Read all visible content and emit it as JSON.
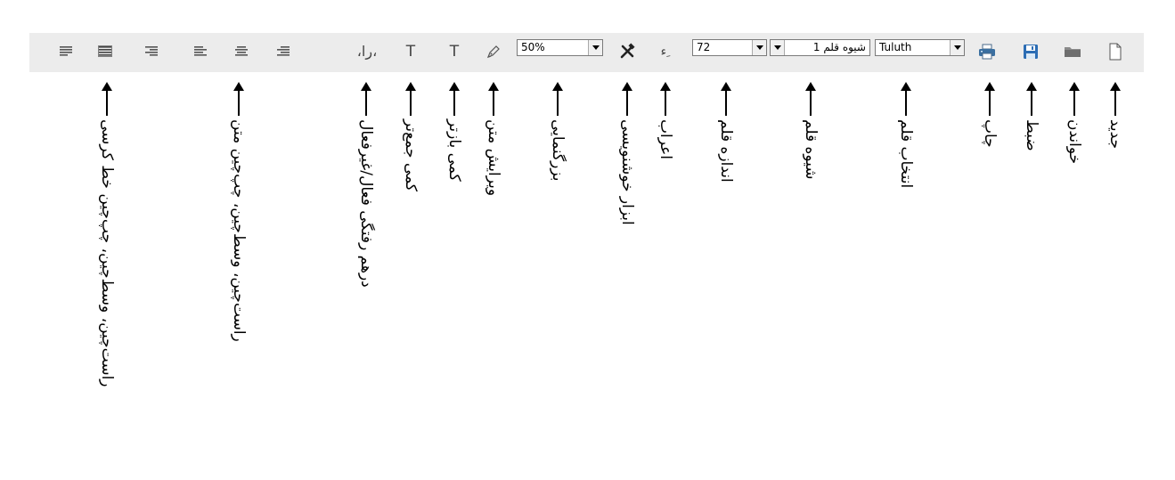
{
  "toolbar": {
    "font_select": "Tuluth",
    "style_select": "شیوه قلم 1",
    "size_select": "72",
    "zoom_select": "50%",
    "glyph_diacritics": "ء ِ",
    "glyph_compress": "T",
    "glyph_expand": "T",
    "glyph_kashida": "،را،"
  },
  "annotations": {
    "new": "جدید",
    "open": "خواندن",
    "save": "ضبط",
    "print": "چاپ",
    "font": "انتخاب قلم",
    "style": "شیوه قلم",
    "size": "اندازه قلم",
    "diacritics": "اعراب",
    "calligraphy_tools": "ابزار خوشنویسی",
    "zoom": "بزرگنمایی",
    "edit_text": "ویرایش متن",
    "expand": "کمی بازتر",
    "compress": "کمی جمع‌تر",
    "kashida": "درهم رفتگی فعال/غیرفعال",
    "align_text": "راست‌چین، وسط‌چین، چپ‌چین متن",
    "align_kashida": "راست‌چین، وسط‌چین، چپ‌چین خط کرسی"
  }
}
